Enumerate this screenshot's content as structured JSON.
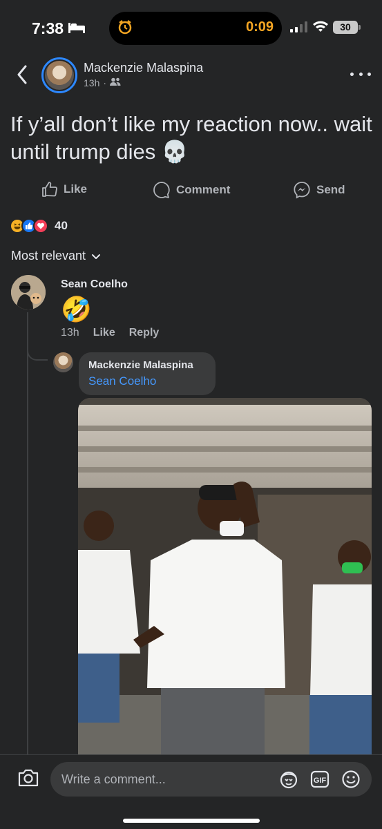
{
  "status_bar": {
    "time": "7:38",
    "timer": "0:09",
    "battery": "30",
    "icons": [
      "bed-icon",
      "alarm-icon",
      "signal-icon",
      "wifi-icon",
      "battery-icon"
    ]
  },
  "header": {
    "author": "Mackenzie Malaspina",
    "time_ago": "13h",
    "separator": "·",
    "audience_icon": "friends-icon"
  },
  "post": {
    "text": "If y’all don’t like my reaction now.. wait until trump dies 💀"
  },
  "actions": {
    "like_label": "Like",
    "comment_label": "Comment",
    "send_label": "Send"
  },
  "reactions": {
    "types": [
      "haha",
      "like",
      "love"
    ],
    "count": "40"
  },
  "sort": {
    "label": "Most relevant"
  },
  "comment": {
    "author": "Sean Coelho",
    "body": "🤣",
    "time_ago": "13h",
    "like_label": "Like",
    "reply_label": "Reply"
  },
  "reply": {
    "author": "Mackenzie Malaspina",
    "mention": "Sean Coelho",
    "attachment": "gif"
  },
  "composer": {
    "placeholder": "Write a comment...",
    "icons": [
      "camera-icon",
      "avatar-sticker-icon",
      "gif-icon",
      "emoji-icon"
    ],
    "gif_label": "GIF"
  },
  "colors": {
    "background": "#242526",
    "bubble": "#3a3b3c",
    "link": "#4599ff",
    "story_ring": "#2d88ff",
    "timer": "#f5a623"
  }
}
